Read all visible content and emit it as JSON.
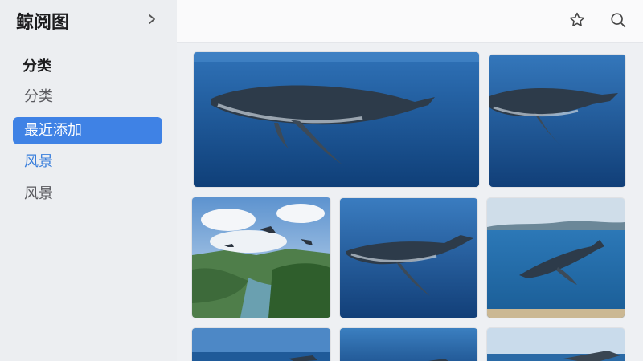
{
  "app": {
    "title": "鲸阅图"
  },
  "sidebar": {
    "section_header": "分类",
    "items": [
      {
        "label": "分类"
      },
      {
        "label": "最近添加"
      },
      {
        "label": "风景"
      },
      {
        "label": "风景"
      }
    ]
  },
  "icons": {
    "collapse": "chevron-right-icon",
    "favorite": "star-icon",
    "search": "search-icon"
  },
  "colors": {
    "accent": "#3f82e5",
    "sidebar_bg": "#eceef1",
    "ocean_deep": "#0f3f78",
    "ocean_light": "#2f72b8"
  },
  "gallery": {
    "photos": [
      {
        "subject": "humpback whale underwater"
      },
      {
        "subject": "humpback whale underwater"
      },
      {
        "subject": "whales flying over tropical island"
      },
      {
        "subject": "humpback whale underwater"
      },
      {
        "subject": "whale in shallow sea near coast"
      },
      {
        "subject": "ocean horizon with whale"
      },
      {
        "subject": "whale underwater"
      },
      {
        "subject": "whale near coast"
      }
    ]
  }
}
